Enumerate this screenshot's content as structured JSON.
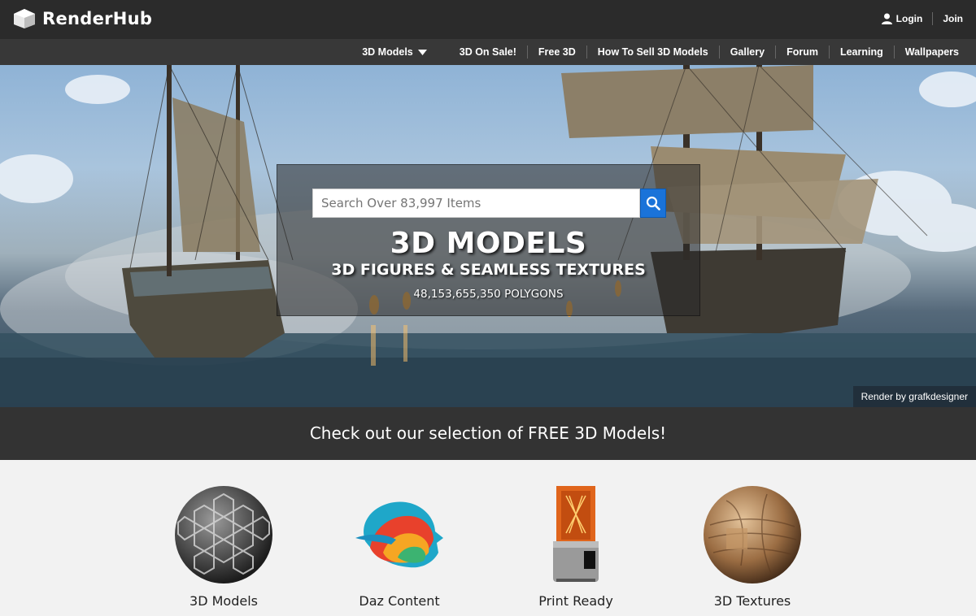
{
  "header": {
    "brand": "RenderHub",
    "login_label": "Login",
    "join_label": "Join"
  },
  "nav": {
    "items": [
      {
        "label": "3D Models",
        "has_dropdown": true
      },
      {
        "label": "3D On Sale!"
      },
      {
        "label": "Free 3D"
      },
      {
        "label": "How To Sell 3D Models"
      },
      {
        "label": "Gallery"
      },
      {
        "label": "Forum"
      },
      {
        "label": "Learning"
      },
      {
        "label": "Wallpapers"
      }
    ]
  },
  "hero": {
    "search_placeholder": "Search Over 83,997 Items",
    "title": "3D MODELS",
    "subtitle": "3D FIGURES & SEAMLESS TEXTURES",
    "polygon_count": "48,153,655,350 POLYGONS",
    "credit": "Render by grafkdesigner"
  },
  "banner": {
    "text": "Check out our selection of FREE 3D Models!"
  },
  "categories": [
    {
      "label": "3D Models",
      "icon": "hex-sphere-icon"
    },
    {
      "label": "Daz Content",
      "icon": "daz-head-icon"
    },
    {
      "label": "Print Ready",
      "icon": "3d-printer-icon"
    },
    {
      "label": "3D Textures",
      "icon": "wood-sphere-icon"
    }
  ],
  "colors": {
    "topbar": "#2b2b2b",
    "navbar": "#383838",
    "search_button": "#1a73d9",
    "banner": "#333333"
  }
}
